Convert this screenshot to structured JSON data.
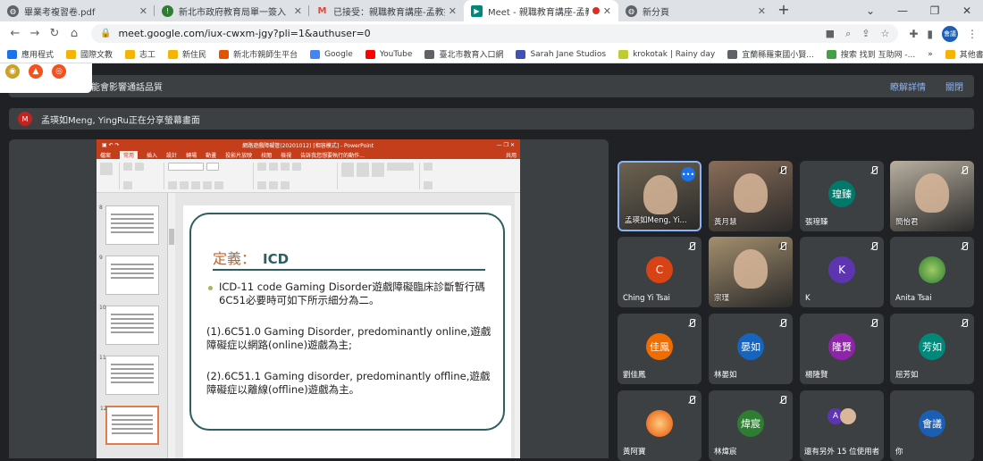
{
  "tabs": [
    {
      "title": "畢業考複習卷.pdf",
      "icon": "globe-icon",
      "color": "#5f6368"
    },
    {
      "title": "新北市政府教育局單一簽入",
      "icon": "ntpc-icon",
      "color": "#2e7d32"
    },
    {
      "title": "已接受：親職教育講座-孟教授",
      "icon": "gmail-icon",
      "color": "#ea4335"
    },
    {
      "title": "Meet - 親職教育講座-孟教授",
      "icon": "meet-icon",
      "color": "#00897b",
      "active": true
    },
    {
      "title": "新分頁",
      "icon": "globe-icon",
      "color": "#5f6368"
    }
  ],
  "address": "meet.google.com/iux-cwxm-jgy?pli=1&authuser=0",
  "profile_label": "會議",
  "bookmarks": [
    {
      "label": "應用程式",
      "color": "#1a73e8"
    },
    {
      "label": "國際文教",
      "color": "#f4b400"
    },
    {
      "label": "志工",
      "color": "#f4b400"
    },
    {
      "label": "新住民",
      "color": "#f4b400"
    },
    {
      "label": "新北市親師生平台",
      "color": "#e65100"
    },
    {
      "label": "Google",
      "color": "#4285f4"
    },
    {
      "label": "YouTube",
      "color": "#ff0000"
    },
    {
      "label": "臺北市教育入口網",
      "color": "#5f6368"
    },
    {
      "label": "Sarah Jane Studios",
      "color": "#3f51b5"
    },
    {
      "label": "krokotak | Rainy day",
      "color": "#c0ca33"
    },
    {
      "label": "宜蘭縣羅東國小賢...",
      "color": "#5f6368"
    },
    {
      "label": "搜索 找到 互助网 -...",
      "color": "#43a047"
    }
  ],
  "bookmarks_more": "»",
  "bookmarks_other": "其他書籤",
  "meet": {
    "notice": "能會影響通話品質",
    "notice_links": [
      "瞭解詳情",
      "關閉"
    ],
    "presenting": "孟瑛如Meng, YingRu正在分享螢幕畫面",
    "presenter_initial": "M"
  },
  "ppt": {
    "window_title": "網路遊戲障礙管(20201012) [相容模式] - PowerPoint",
    "menu": [
      "檔案",
      "常用",
      "插入",
      "設計",
      "轉場",
      "動畫",
      "投影片放映",
      "校閱",
      "檢視",
      "告訴我您想要執行的動作..."
    ],
    "share_label": "共用",
    "slide_numbers": [
      "8",
      "9",
      "10",
      "11",
      "12"
    ],
    "slide": {
      "title": "定義：",
      "title_term": "ICD",
      "bullet": "ICD-11 code Gaming Disorder遊戲障礙臨床診斷暫行碼6C51必要時可如下所示細分為二。",
      "para1": "(1).6C51.0 Gaming Disorder, predominantly online,遊戲障礙症以網路(online)遊戲為主;",
      "para2": "(2).6C51.1 Gaming disorder, predominantly offline,遊戲障礙症以離線(offline)遊戲為主。"
    }
  },
  "participants": [
    {
      "name": "孟瑛如Meng, Yi...",
      "type": "video",
      "bg": "#6d6250",
      "highlight": true
    },
    {
      "name": "黃月慧",
      "type": "video",
      "bg": "#8a6d58"
    },
    {
      "name": "張瑝臻",
      "type": "avatar",
      "initial": "瑝臻",
      "color": "#00796b"
    },
    {
      "name": "簡怡君",
      "type": "video",
      "bg": "#b9b0a0"
    },
    {
      "name": "Ching Yi Tsai",
      "type": "avatar",
      "initial": "C",
      "color": "#d84315"
    },
    {
      "name": "宗瑾",
      "type": "video",
      "bg": "#a58f6e"
    },
    {
      "name": "K",
      "type": "avatar",
      "initial": "K",
      "color": "#5e35b1"
    },
    {
      "name": "Anita Tsai",
      "type": "avatar",
      "initial": "",
      "color": "#43a047"
    },
    {
      "name": "劉佳鳳",
      "type": "avatar",
      "initial": "佳鳳",
      "color": "#ef6c00"
    },
    {
      "name": "林晏如",
      "type": "avatar",
      "initial": "晏如",
      "color": "#1565c0"
    },
    {
      "name": "楊隆賢",
      "type": "avatar",
      "initial": "隆賢",
      "color": "#8e24aa"
    },
    {
      "name": "屈芳如",
      "type": "avatar",
      "initial": "芳如",
      "color": "#00897b"
    },
    {
      "name": "黃阿寶",
      "type": "avatar",
      "initial": "",
      "color": "#fafafa"
    },
    {
      "name": "林煒宸",
      "type": "avatar",
      "initial": "煒宸",
      "color": "#2e7d32"
    },
    {
      "name": "還有另外 15 位使用者",
      "type": "more",
      "initial": "A"
    },
    {
      "name": "你",
      "type": "avatar",
      "initial": "會議",
      "color": "#1a5fb4"
    }
  ]
}
